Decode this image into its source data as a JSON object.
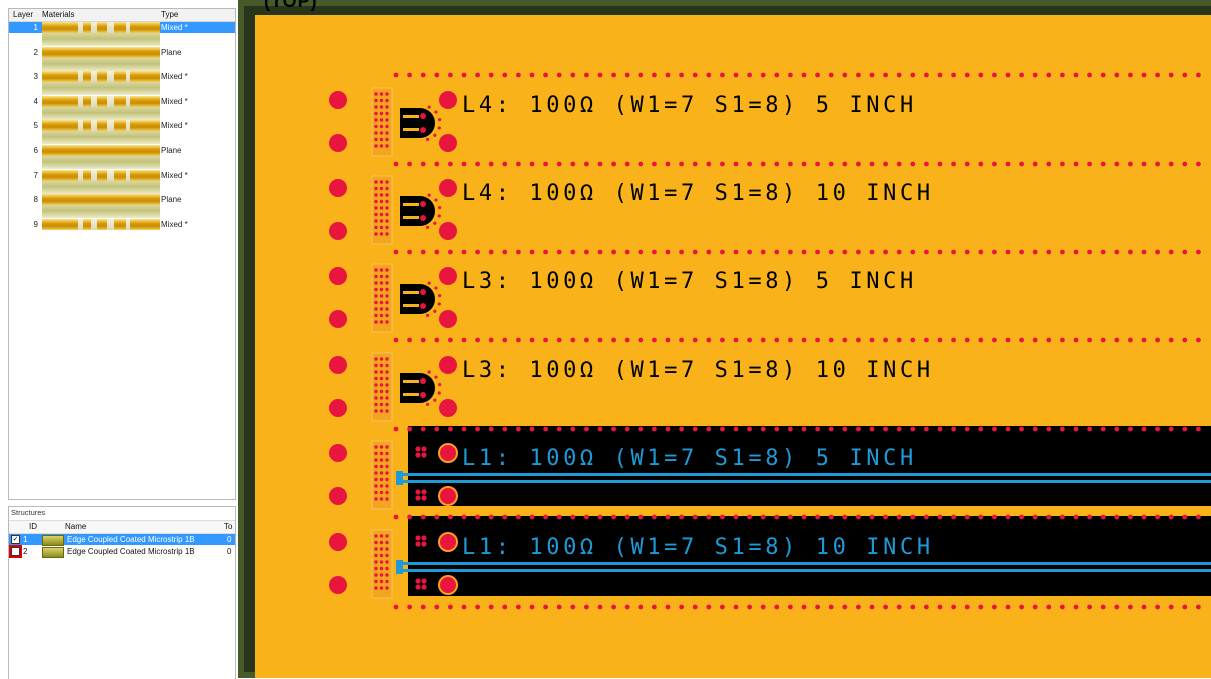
{
  "window": {
    "title_fragment": "(TOP)"
  },
  "layer_table": {
    "headers": {
      "layer": "Layer",
      "materials": "Materials",
      "type": "Type"
    },
    "rows": [
      {
        "layer": "1",
        "type": "Mixed *",
        "selected": true
      },
      {
        "layer": "2",
        "type": "Plane"
      },
      {
        "layer": "3",
        "type": "Mixed *"
      },
      {
        "layer": "4",
        "type": "Mixed *"
      },
      {
        "layer": "5",
        "type": "Mixed *"
      },
      {
        "layer": "6",
        "type": "Plane"
      },
      {
        "layer": "7",
        "type": "Mixed *"
      },
      {
        "layer": "8",
        "type": "Plane"
      },
      {
        "layer": "9",
        "type": "Mixed *"
      }
    ]
  },
  "structures": {
    "title": "Structures",
    "headers": {
      "id": "ID",
      "name": "Name",
      "to": "To"
    },
    "rows": [
      {
        "id": "1",
        "name": "Edge Coupled Coated Microstrip 1B",
        "value": "0",
        "checked": true,
        "selected": true
      },
      {
        "id": "2",
        "name": "Edge Coupled Coated Microstrip 1B",
        "value": "0",
        "checked": false,
        "highlighted": true
      }
    ]
  },
  "board": {
    "colors": {
      "frame": "#465a2a",
      "pcb": "#f9b21a",
      "via": "#e8163f",
      "black_area": "#000000",
      "trace": "#1e9bd7",
      "label_dark": "#000000"
    },
    "labels": [
      {
        "text": "L4:  100Ω (W1=7 S1=8)  5 INCH"
      },
      {
        "text": "L4:  100Ω (W1=7 S1=8)  10 INCH"
      },
      {
        "text": "L3:  100Ω (W1=7 S1=8)  5 INCH"
      },
      {
        "text": "L3:  100Ω (W1=7 S1=8)  10 INCH"
      },
      {
        "text": "L1:  100Ω (W1=7 S1=8)  5 INCH"
      },
      {
        "text": "L1:  100Ω (W1=7 S1=8)  10 INCH"
      }
    ]
  }
}
